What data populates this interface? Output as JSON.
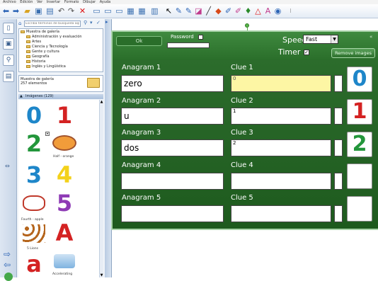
{
  "menu": [
    "Archivo",
    "Edición",
    "Ver",
    "Insertar",
    "Formato",
    "Dibujar",
    "Ayuda"
  ],
  "gallery": {
    "search_placeholder": "Escriba términos de búsqueda aquí",
    "tree_items": [
      "Muestra de galería",
      "Administración y evaluación",
      "Artes",
      "Ciencia y Tecnología",
      "Gente y cultura",
      "Geografía",
      "Historia",
      "Inglés y Lingüística"
    ],
    "collection_title": "Muestra de galería",
    "collection_count": "257 elementos",
    "section_label": "Imágenes (129)",
    "captions": [
      "Half - orange",
      "Fourth - apple",
      "5 Lions",
      "Accelerating"
    ]
  },
  "activity": {
    "ok_label": "Ok",
    "password_label": "Password",
    "speed_label": "Speed",
    "speed_value": "Fast",
    "timer_label": "Timer",
    "timer_checked": "✓",
    "remove_images_label": "Remove images",
    "rows": [
      {
        "anagram_label": "Anagram 1",
        "anagram_value": "zero",
        "clue_label": "Clue 1",
        "clue_value": "0",
        "image": "0",
        "image_color": "#1e86c9"
      },
      {
        "anagram_label": "Anagram 2",
        "anagram_value": "u",
        "clue_label": "Clue 2",
        "clue_value": "1",
        "image": "1",
        "image_color": "#d42222"
      },
      {
        "anagram_label": "Anagram 3",
        "anagram_value": "dos",
        "clue_label": "Clue 3",
        "clue_value": "2",
        "image": "2",
        "image_color": "#23963b"
      },
      {
        "anagram_label": "Anagram 4",
        "anagram_value": "",
        "clue_label": "Clue 4",
        "clue_value": "",
        "image": "",
        "image_color": "#000000"
      },
      {
        "anagram_label": "Anagram 5",
        "anagram_value": "",
        "clue_label": "Clue 5",
        "clue_value": "",
        "image": "",
        "image_color": "#000000"
      }
    ]
  },
  "colors": {
    "accent_green": "#2e6f2e",
    "highlight_yellow": "#fdf6a4"
  }
}
